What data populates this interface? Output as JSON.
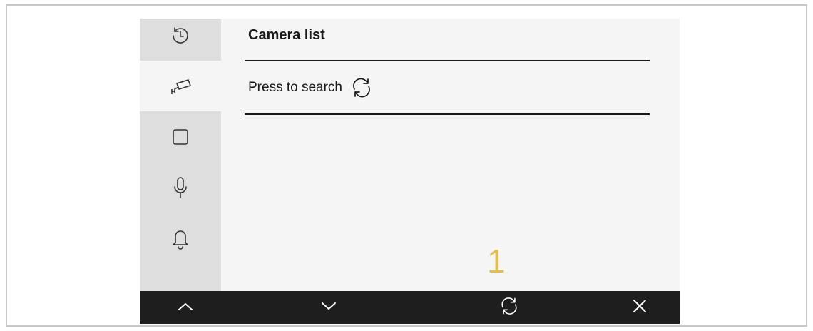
{
  "header": {
    "title": "Camera list"
  },
  "list": {
    "search_label": "Press to search"
  },
  "callout": {
    "number": "1",
    "color": "#e3be4d"
  },
  "sidebar": {
    "items": [
      {
        "icon": "history-icon",
        "active": false
      },
      {
        "icon": "camera-icon",
        "active": true
      },
      {
        "icon": "square-icon",
        "active": false
      },
      {
        "icon": "microphone-icon",
        "active": false
      },
      {
        "icon": "bell-icon",
        "active": false
      }
    ]
  },
  "bottom_bar": {
    "buttons": [
      {
        "icon": "chevron-up-icon"
      },
      {
        "icon": "chevron-down-icon"
      },
      {
        "icon": "refresh-icon"
      },
      {
        "icon": "close-icon"
      }
    ]
  },
  "colors": {
    "sidebar_bg": "#dedede",
    "screen_bg": "#f5f5f5",
    "bottom_bar_bg": "#1e1e1e",
    "accent": "#e3be4d"
  }
}
